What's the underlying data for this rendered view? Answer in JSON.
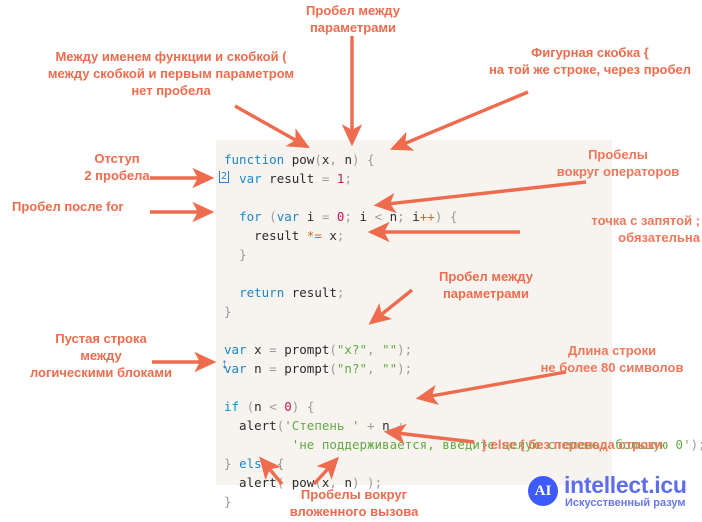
{
  "annotations": {
    "space_between_params_top": "Пробел между\nпараметрами",
    "between_name_and_paren": "Между именем функции и скобкой (\nмежду скобкой и первым параметром\nнет пробела",
    "curly_brace": "Фигурная скобка {\nна той же строке, через пробел",
    "indent": "Отступ\n2 пробела",
    "space_after_for": "Пробел после for",
    "spaces_around_operators": "Пробелы\nвокруг операторов",
    "semicolon_required": "точка с запятой ;\nобязательна",
    "space_between_params_mid": "Пробел между\nпараметрами",
    "blank_line": "Пустая строка\nмежду\nлогическими блоками",
    "line_length": "Длина строки\nне более 80 символов",
    "else_same_line": "} else { без перевода строки",
    "spaces_nested_call": "Пробелы вокруг\nвложенного вызова"
  },
  "code": {
    "lines": [
      {
        "id": "l1",
        "tokens": [
          {
            "t": "function",
            "c": "kw"
          },
          {
            "t": " ",
            "c": "id"
          },
          {
            "t": "pow",
            "c": "id"
          },
          {
            "t": "(",
            "c": "pun"
          },
          {
            "t": "x",
            "c": "id"
          },
          {
            "t": ", ",
            "c": "pun"
          },
          {
            "t": "n",
            "c": "id"
          },
          {
            "t": ") ",
            "c": "pun"
          },
          {
            "t": "{",
            "c": "pun"
          }
        ]
      },
      {
        "id": "l2",
        "tokens": [
          {
            "t": "  ",
            "c": "id"
          },
          {
            "t": "var",
            "c": "kw"
          },
          {
            "t": " result ",
            "c": "id"
          },
          {
            "t": "=",
            "c": "pun"
          },
          {
            "t": " ",
            "c": "id"
          },
          {
            "t": "1",
            "c": "num"
          },
          {
            "t": ";",
            "c": "pun"
          }
        ]
      },
      {
        "id": "l3",
        "tokens": [
          {
            "t": "",
            "c": "id"
          }
        ]
      },
      {
        "id": "l4",
        "tokens": [
          {
            "t": "  ",
            "c": "id"
          },
          {
            "t": "for",
            "c": "kw"
          },
          {
            "t": " ",
            "c": "id"
          },
          {
            "t": "(",
            "c": "pun"
          },
          {
            "t": "var",
            "c": "kw"
          },
          {
            "t": " i ",
            "c": "id"
          },
          {
            "t": "=",
            "c": "pun"
          },
          {
            "t": " ",
            "c": "id"
          },
          {
            "t": "0",
            "c": "num"
          },
          {
            "t": "; ",
            "c": "pun"
          },
          {
            "t": "i ",
            "c": "id"
          },
          {
            "t": "<",
            "c": "pun"
          },
          {
            "t": " n",
            "c": "id"
          },
          {
            "t": "; ",
            "c": "pun"
          },
          {
            "t": "i",
            "c": "id"
          },
          {
            "t": "++",
            "c": "op"
          },
          {
            "t": ") ",
            "c": "pun"
          },
          {
            "t": "{",
            "c": "pun"
          }
        ]
      },
      {
        "id": "l5",
        "tokens": [
          {
            "t": "    result ",
            "c": "id"
          },
          {
            "t": "*=",
            "c": "op"
          },
          {
            "t": " x",
            "c": "id"
          },
          {
            "t": ";",
            "c": "pun"
          }
        ]
      },
      {
        "id": "l6",
        "tokens": [
          {
            "t": "  ",
            "c": "id"
          },
          {
            "t": "}",
            "c": "pun"
          }
        ]
      },
      {
        "id": "l7",
        "tokens": [
          {
            "t": "",
            "c": "id"
          }
        ]
      },
      {
        "id": "l8",
        "tokens": [
          {
            "t": "  ",
            "c": "id"
          },
          {
            "t": "return",
            "c": "kw"
          },
          {
            "t": " result",
            "c": "id"
          },
          {
            "t": ";",
            "c": "pun"
          }
        ]
      },
      {
        "id": "l9",
        "tokens": [
          {
            "t": "}",
            "c": "pun"
          }
        ]
      },
      {
        "id": "l10",
        "tokens": [
          {
            "t": "",
            "c": "id"
          }
        ]
      },
      {
        "id": "l11",
        "tokens": [
          {
            "t": "var",
            "c": "kw"
          },
          {
            "t": " x ",
            "c": "id"
          },
          {
            "t": "=",
            "c": "pun"
          },
          {
            "t": " prompt",
            "c": "id"
          },
          {
            "t": "(",
            "c": "pun"
          },
          {
            "t": "\"x?\"",
            "c": "str2"
          },
          {
            "t": ", ",
            "c": "pun"
          },
          {
            "t": "\"\"",
            "c": "str2"
          },
          {
            "t": ");",
            "c": "pun"
          }
        ]
      },
      {
        "id": "l12",
        "tokens": [
          {
            "t": "var",
            "c": "kw"
          },
          {
            "t": " n ",
            "c": "id"
          },
          {
            "t": "=",
            "c": "pun"
          },
          {
            "t": " prompt",
            "c": "id"
          },
          {
            "t": "(",
            "c": "pun"
          },
          {
            "t": "\"n?\"",
            "c": "str2"
          },
          {
            "t": ", ",
            "c": "pun"
          },
          {
            "t": "\"\"",
            "c": "str2"
          },
          {
            "t": ");",
            "c": "pun"
          }
        ]
      },
      {
        "id": "l13",
        "tokens": [
          {
            "t": "",
            "c": "id"
          }
        ]
      },
      {
        "id": "l14",
        "tokens": [
          {
            "t": "if",
            "c": "kw"
          },
          {
            "t": " ",
            "c": "id"
          },
          {
            "t": "(",
            "c": "pun"
          },
          {
            "t": "n ",
            "c": "id"
          },
          {
            "t": "<",
            "c": "pun"
          },
          {
            "t": " ",
            "c": "id"
          },
          {
            "t": "0",
            "c": "num"
          },
          {
            "t": ") ",
            "c": "pun"
          },
          {
            "t": "{",
            "c": "pun"
          }
        ]
      },
      {
        "id": "l15",
        "tokens": [
          {
            "t": "  alert",
            "c": "id"
          },
          {
            "t": "(",
            "c": "pun"
          },
          {
            "t": "'Степень '",
            "c": "str"
          },
          {
            "t": " ",
            "c": "id"
          },
          {
            "t": "+",
            "c": "pun"
          },
          {
            "t": " n ",
            "c": "id"
          },
          {
            "t": "+",
            "c": "pun"
          }
        ]
      },
      {
        "id": "l16",
        "tokens": [
          {
            "t": "         ",
            "c": "id"
          },
          {
            "t": "'не поддерживается, введите целую степень, большую 0'",
            "c": "str"
          },
          {
            "t": ");",
            "c": "pun"
          }
        ]
      },
      {
        "id": "l17",
        "tokens": [
          {
            "t": "}",
            "c": "pun"
          },
          {
            "t": " ",
            "c": "id"
          },
          {
            "t": "else",
            "c": "kw"
          },
          {
            "t": " ",
            "c": "id"
          },
          {
            "t": "{",
            "c": "pun"
          }
        ]
      },
      {
        "id": "l18",
        "tokens": [
          {
            "t": "  alert",
            "c": "id"
          },
          {
            "t": "( ",
            "c": "pun"
          },
          {
            "t": "pow",
            "c": "id"
          },
          {
            "t": "(",
            "c": "pun"
          },
          {
            "t": "x",
            "c": "id"
          },
          {
            "t": ", ",
            "c": "pun"
          },
          {
            "t": "n",
            "c": "id"
          },
          {
            "t": ") ",
            "c": "pun"
          },
          {
            "t": ");",
            "c": "pun"
          }
        ]
      },
      {
        "id": "l19",
        "tokens": [
          {
            "t": "}",
            "c": "pun"
          }
        ]
      }
    ]
  },
  "markers": {
    "indent_two": "2",
    "blank_line_arrow": "↕"
  },
  "logo": {
    "mark": "AI",
    "name": "intellect.icu",
    "tagline": "Искусственный разум"
  },
  "colors": {
    "annotation": "#ee6c4d",
    "code_bg": "#f7f4f0",
    "keyword": "#1a87c9",
    "string": "#63a844",
    "number": "#c2185b",
    "logo": "#4355e8"
  }
}
